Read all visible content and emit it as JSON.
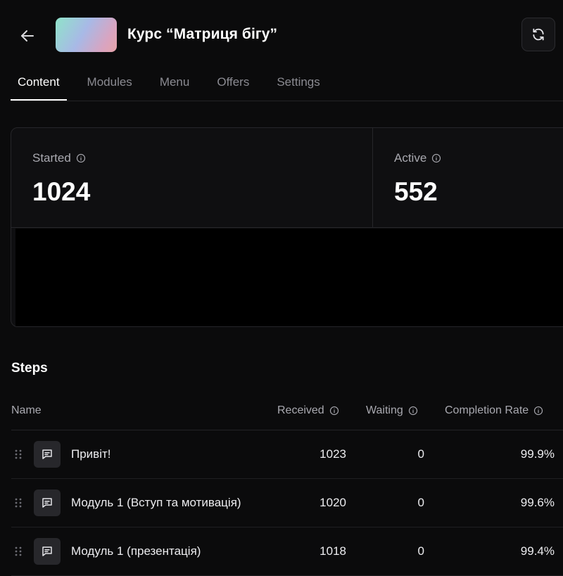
{
  "header": {
    "title": "Курс “Матриця бігу”",
    "back_icon": "arrow-left-icon",
    "refresh_icon": "refresh-icon",
    "thumbnail_gradient": [
      "#8fe3c9",
      "#a8b9e6",
      "#e6a3a8"
    ]
  },
  "tabs": [
    {
      "label": "Content",
      "active": true
    },
    {
      "label": "Modules",
      "active": false
    },
    {
      "label": "Menu",
      "active": false
    },
    {
      "label": "Offers",
      "active": false
    },
    {
      "label": "Settings",
      "active": false
    }
  ],
  "stats": [
    {
      "label": "Started",
      "value": "1024"
    },
    {
      "label": "Active",
      "value": "552"
    }
  ],
  "steps": {
    "title": "Steps",
    "columns": [
      "Name",
      "Received",
      "Waiting",
      "Completion Rate"
    ],
    "rows": [
      {
        "name": "Привіт!",
        "received": "1023",
        "waiting": "0",
        "rate": "99.9%"
      },
      {
        "name": "Модуль 1 (Вступ та мотивація)",
        "received": "1020",
        "waiting": "0",
        "rate": "99.6%"
      },
      {
        "name": "Модуль 1 (презентація)",
        "received": "1018",
        "waiting": "0",
        "rate": "99.4%"
      }
    ]
  },
  "colors": {
    "background": "#0b0b0c",
    "text_primary": "#ffffff",
    "text_muted": "#a9a9b0",
    "border": "#26262a"
  }
}
